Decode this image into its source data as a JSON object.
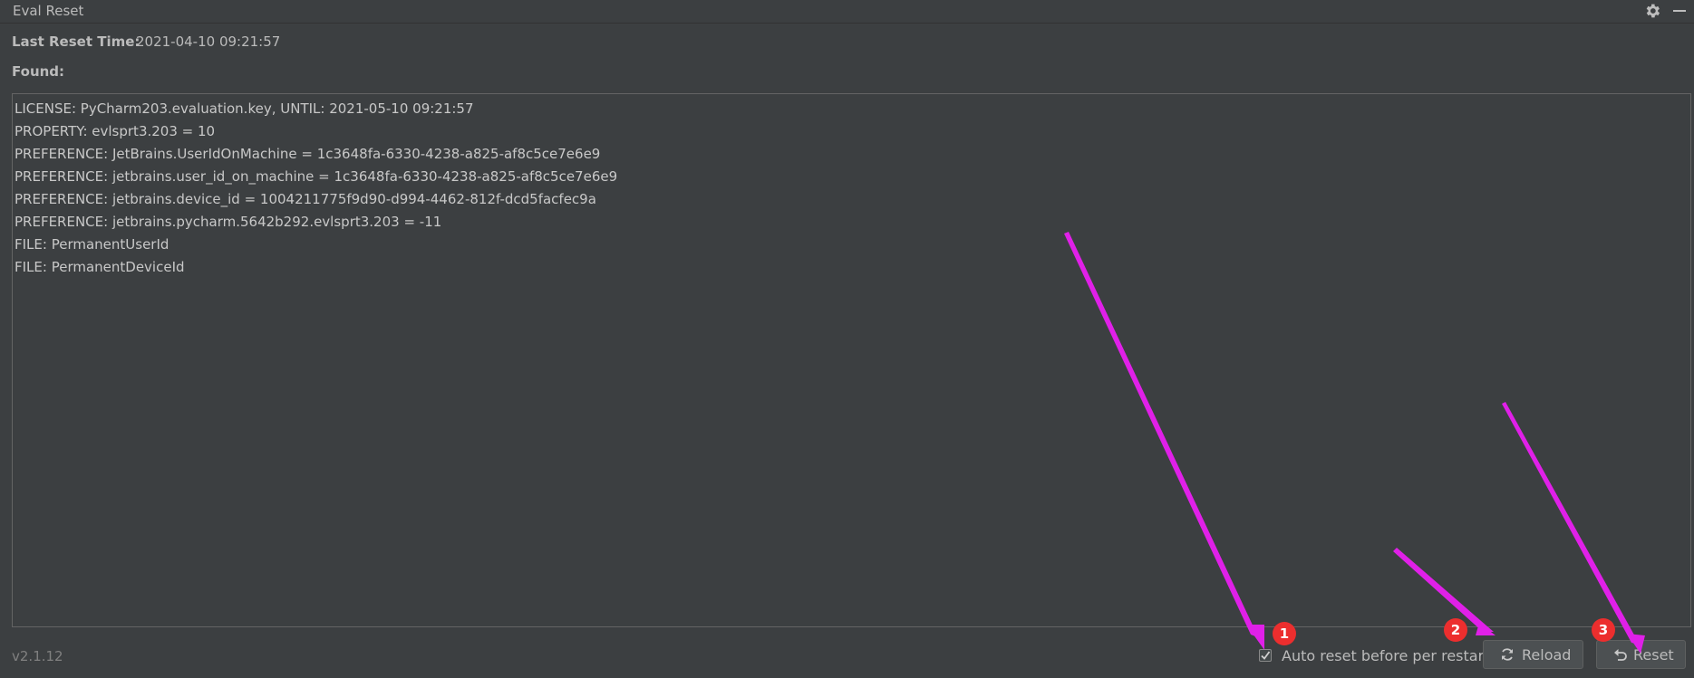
{
  "window": {
    "title": "Eval Reset",
    "settings_icon": "gear-icon",
    "minimize_icon": "minimize-icon"
  },
  "info": {
    "last_reset_label": "Last Reset Time:",
    "last_reset_value": "2021-04-10 09:21:57",
    "found_label": "Found:"
  },
  "found_lines": [
    "LICENSE: PyCharm203.evaluation.key, UNTIL: 2021-05-10 09:21:57",
    "PROPERTY: evlsprt3.203 = 10",
    "PREFERENCE: JetBrains.UserIdOnMachine = 1c3648fa-6330-4238-a825-af8c5ce7e6e9",
    "PREFERENCE: jetbrains.user_id_on_machine = 1c3648fa-6330-4238-a825-af8c5ce7e6e9",
    "PREFERENCE: jetbrains.device_id = 1004211775f9d90-d994-4462-812f-dcd5facfec9a",
    "PREFERENCE: jetbrains.pycharm.5642b292.evlsprt3.203 = -11",
    "FILE: PermanentUserId",
    "FILE: PermanentDeviceId"
  ],
  "footer": {
    "version": "v2.1.12",
    "auto_reset_label": "Auto reset before per restart",
    "auto_reset_checked": true,
    "reload_label": "Reload",
    "reload_icon": "refresh-icon",
    "reset_label": "Reset",
    "reset_icon": "undo-icon"
  },
  "annotations": {
    "badges": [
      "1",
      "2",
      "3"
    ],
    "arrow_color": "#e020e8",
    "badge_color": "#ec2e2e"
  }
}
